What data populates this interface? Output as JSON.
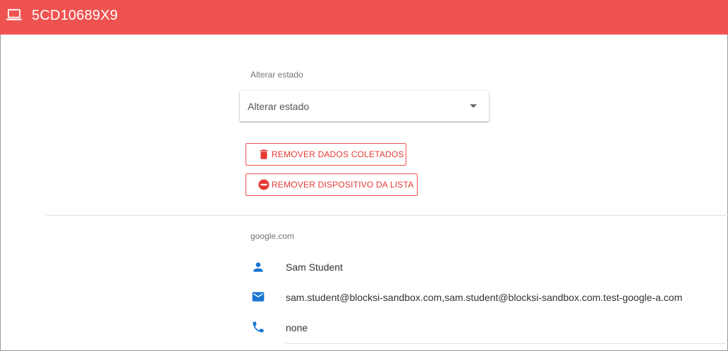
{
  "header": {
    "device_id": "5CD10689X9",
    "icon": "laptop-icon",
    "color": "#ef5350"
  },
  "state": {
    "section_label": "Alterar estado",
    "select_value": "Alterar estado"
  },
  "actions": {
    "remove_data_label": "REMOVER DADOS COLETADOS",
    "remove_device_label": "REMOVER DISPOSITIVO DA LISTA",
    "accent": "#e53935"
  },
  "account": {
    "domain": "google.com",
    "name": "Sam Student",
    "email": "sam.student@blocksi-sandbox.com,sam.student@blocksi-sandbox.com.test-google-a.com",
    "phone": "none",
    "icon_color": "#1976d2"
  }
}
